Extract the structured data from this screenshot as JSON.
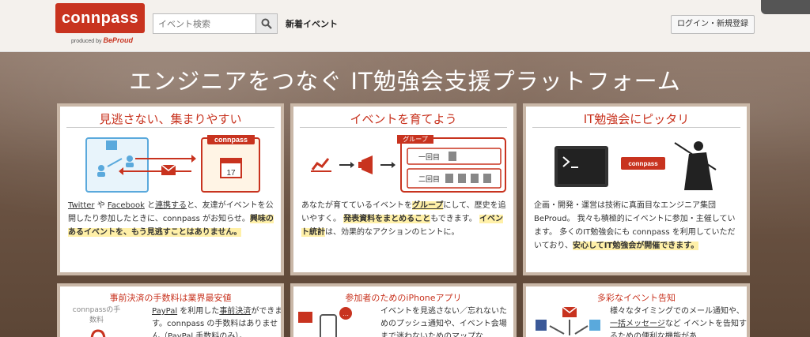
{
  "header": {
    "logo": "connpass",
    "logo_sub_prefix": "produced by",
    "logo_sub_brand": "BeProud",
    "search_placeholder": "イベント検索",
    "nav_new": "新着イベント",
    "login": "ログイン・新規登録"
  },
  "hero": {
    "title": "エンジニアをつなぐ IT勉強会支援プラットフォーム"
  },
  "cards": [
    {
      "title": "見逃さない、集まりやすい",
      "graphic_label": "connpass",
      "calendar_day": "17",
      "t1": "Twitter",
      "t2": " や ",
      "t3": "Facebook",
      "t4": " と",
      "t5": "連携する",
      "t6": "と、友達がイベントを公開したり参加したときに、connpass がお知らせ。",
      "t7": "興味のあるイベントを、もう見逃すことはありません。"
    },
    {
      "title": "イベントを育てよう",
      "group_label": "グループ",
      "row1": "一回目",
      "row2": "二回目",
      "t1": "あなたが育てているイベントを",
      "t2": "グループ",
      "t3": "にして、歴史を追いやすく。",
      "t4": "発表資料をまとめること",
      "t5": "もできます。",
      "t6": "イベント統計",
      "t7": "は、効果的なアクションのヒントに。"
    },
    {
      "title": "IT勉強会にピッタリ",
      "graphic_label": "connpass",
      "t1": "企画・開発・運営は技術に真面目なエンジニア集団 BeProud。 我々も積極的にイベントに参加・主催しています。 多くのIT勉強会にも connpass を利用していただいており、",
      "t2": "安心してIT勉強会が開催できます。"
    }
  ],
  "bottom": [
    {
      "title": "事前決済の手数料は業界最安値",
      "side": "connpassの手数料",
      "t1": "PayPal",
      "t2": " を利用した",
      "t3": "事前決済",
      "t4": "ができます。connpass の手数料はありません（PayPal 手数料のみ）。"
    },
    {
      "title": "参加者のためのiPhoneアプリ",
      "text": "イベントを見逃さない／忘れないためのプッシュ通知や、イベント会場まで迷わないためのマップな"
    },
    {
      "title": "多彩なイベント告知",
      "t1": "様々なタイミングでのメール通知や、",
      "t2": "一括メッセージ",
      "t3": "など イベントを告知するための便利な機能があ"
    }
  ],
  "colors": {
    "brand": "#c8331f",
    "highlight": "#fff0a8",
    "frame": "#c9b7a7"
  }
}
